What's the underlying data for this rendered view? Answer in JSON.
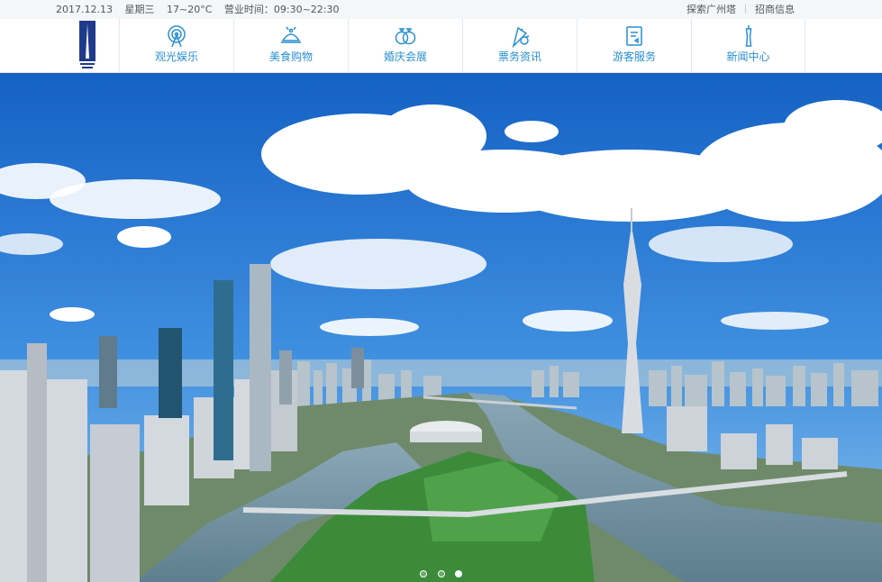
{
  "topbar": {
    "date": "2017.12.13",
    "weekday": "星期三",
    "temperature": "17~20°C",
    "hours": "营业时间：09:30~22:30",
    "links": [
      "探索广州塔",
      "招商信息"
    ]
  },
  "nav": {
    "items": [
      {
        "label": "观光娱乐",
        "icon": "ferris-wheel-icon"
      },
      {
        "label": "美食购物",
        "icon": "food-tray-icon"
      },
      {
        "label": "婚庆会展",
        "icon": "rings-icon"
      },
      {
        "label": "票务资讯",
        "icon": "ticket-icon"
      },
      {
        "label": "游客服务",
        "icon": "service-doc-icon"
      },
      {
        "label": "新闻中心",
        "icon": "tower-icon"
      }
    ]
  },
  "banner": {
    "slides": 3,
    "active_slide": 3
  },
  "colors": {
    "accent": "#2a8fd0",
    "topbar_bg": "#f4f7f9"
  }
}
